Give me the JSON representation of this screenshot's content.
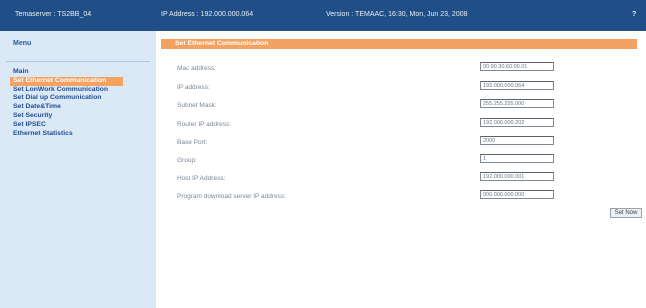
{
  "header": {
    "server": "Temaserver : TS2BB_04",
    "ip": "IP Address : 192.000.000.064",
    "version": "Version : TEMAAC, 16:30, Mon, Jun 23, 2008",
    "help": "?"
  },
  "sidebar": {
    "title": "Menu",
    "items": [
      {
        "label": "Main"
      },
      {
        "label": "Set Ethernet Communication",
        "active": true
      },
      {
        "label": "Set LonWork Communication"
      },
      {
        "label": "Set Dial up Communication"
      },
      {
        "label": "Set Date&Time"
      },
      {
        "label": "Set Security"
      },
      {
        "label": "Set IPSEC"
      },
      {
        "label": "Ethernet Statistics"
      }
    ]
  },
  "main": {
    "section_title": "Set Ethernet Communication",
    "fields": [
      {
        "label": "Mac address:",
        "value": "00.90.30.60.00.01"
      },
      {
        "label": "IP address:",
        "value": "192.000.000.064"
      },
      {
        "label": "Subnet Mask:",
        "value": "255.255.255.000"
      },
      {
        "label": "Router IP address:",
        "value": "192.000.000.202"
      },
      {
        "label": "Base Port:",
        "value": "2000"
      },
      {
        "label": "Group:",
        "value": "1"
      },
      {
        "label": "Host IP Address:",
        "value": "192.000.000.001"
      },
      {
        "label": "Program download server IP address:",
        "value": "000.000.000.000"
      }
    ],
    "set_button": "Set Now"
  },
  "colors": {
    "header_bg": "#1f4f86",
    "sidebar_bg": "#dbe8f6",
    "accent": "#f4a261",
    "menu_text": "#224f90"
  }
}
